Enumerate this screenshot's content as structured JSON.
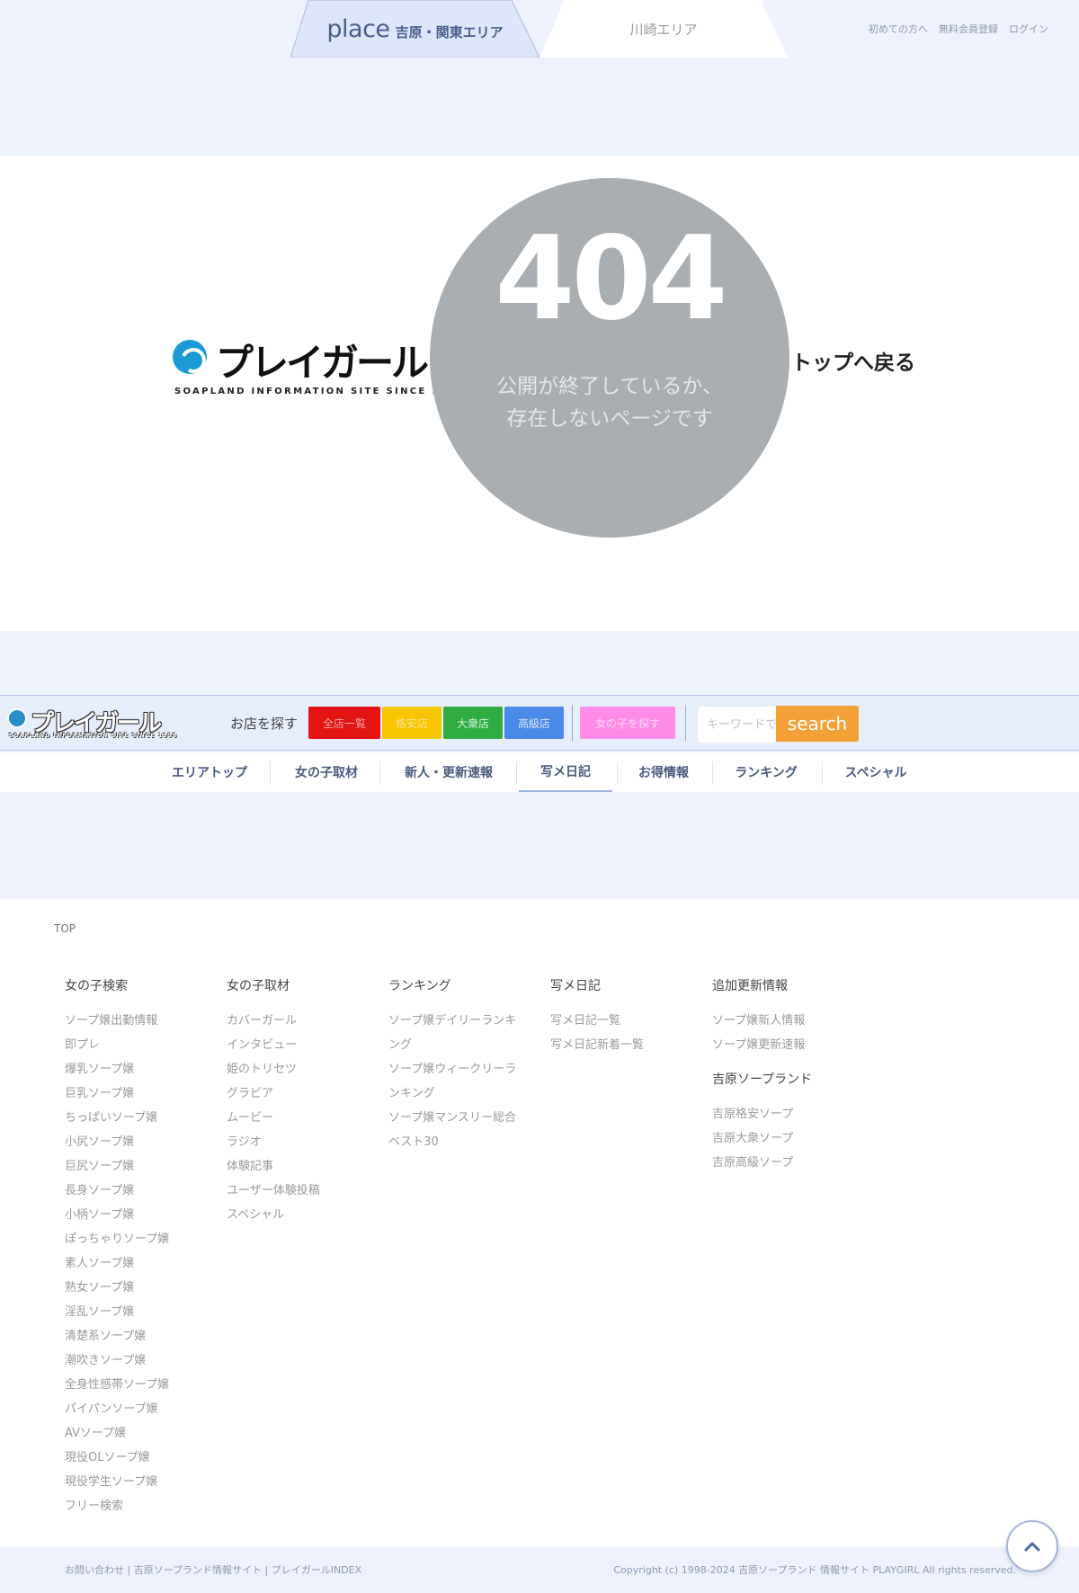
{
  "header": {
    "tab_place_word": "place",
    "tab_yoshiwara": "吉原・関東エリア",
    "tab_kawasaki": "川崎エリア",
    "links": [
      "初めての方へ",
      "無料会員登録",
      "ログイン"
    ]
  },
  "error": {
    "logo_text": "プレイガール",
    "logo_sub": "SOAPLAND INFORMATION SITE SINCE 1998",
    "code": "404",
    "message": "公開が終了しているか、\n存在しないページです",
    "back_link": "トップへ戻る"
  },
  "nav": {
    "logo_text": "プレイガール",
    "logo_sub": "SOAPLAND INFORMATION SITE SINCE 1998",
    "shop_search_label": "お店を探す",
    "btn_all": "全店一覧",
    "btn_cheap": "格安店",
    "btn_popular": "大衆店",
    "btn_high": "高級店",
    "btn_girl": "女の子を探す",
    "keyword_placeholder": "キーワードで",
    "search_label": "search",
    "menu": [
      "エリアトップ",
      "女の子取材",
      "新人・更新速報",
      "写メ日記",
      "お得情報",
      "ランキング",
      "スペシャル"
    ],
    "active_menu": "写メ日記"
  },
  "footer": {
    "breadcrumb": "TOP",
    "col1": {
      "title": "女の子検索",
      "items": [
        "ソープ嬢出勤情報",
        "即プレ",
        "爆乳ソープ嬢",
        "巨乳ソープ嬢",
        "ちっぱいソープ嬢",
        "小尻ソープ嬢",
        "巨尻ソープ嬢",
        "長身ソープ嬢",
        "小柄ソープ嬢",
        "ぽっちゃりソープ嬢",
        "素人ソープ嬢",
        "熟女ソープ嬢",
        "淫乱ソープ嬢",
        "清楚系ソープ嬢",
        "潮吹きソープ嬢",
        "全身性感帯ソープ嬢",
        "パイパンソープ嬢",
        "AVソープ嬢",
        "現役OLソープ嬢",
        "現役学生ソープ嬢",
        "フリー検索"
      ]
    },
    "col2": {
      "title": "女の子取材",
      "items": [
        "カバーガール",
        "インタビュー",
        "姫のトリセツ",
        "グラビア",
        "ムービー",
        "ラジオ",
        "体験記事",
        "ユーザー体験投稿",
        "スペシャル"
      ]
    },
    "col3": {
      "title": "ランキング",
      "items": [
        "ソープ嬢デイリーランキ",
        "ング",
        "ソープ嬢ウィークリーラ",
        "ンキング",
        "ソープ嬢マンスリー総合",
        "ベスト30"
      ]
    },
    "col4": {
      "title": "写メ日記",
      "items": [
        "写メ日記一覧",
        "写メ日記新着一覧"
      ]
    },
    "col5": {
      "title": "追加更新情報",
      "items": [
        "ソープ嬢新人情報",
        "ソープ嬢更新速報"
      ],
      "title2": "吉原ソープランド",
      "items2": [
        "吉原格安ソープ",
        "吉原大衆ソープ",
        "吉原高級ソープ"
      ]
    },
    "copy_left": "お問い合わせ | 吉原ソープランド情報サイト | プレイガールINDEX",
    "copy_right": "Copyright (c) 1998-2024 吉原ソープランド 情報サイト PLAYGIRL All rights reserved."
  },
  "colors": {
    "accent_blue": "#4a5f8c",
    "btn_all": "#e41414",
    "btn_cheap": "#f7c600",
    "btn_popular": "#2fad42",
    "btn_high": "#4a8ae8",
    "btn_girl": "#ff8ce6",
    "search": "#f3a136",
    "circle": "#a9aeb2"
  },
  "icons": {
    "to_top": "chevron-up-icon"
  }
}
